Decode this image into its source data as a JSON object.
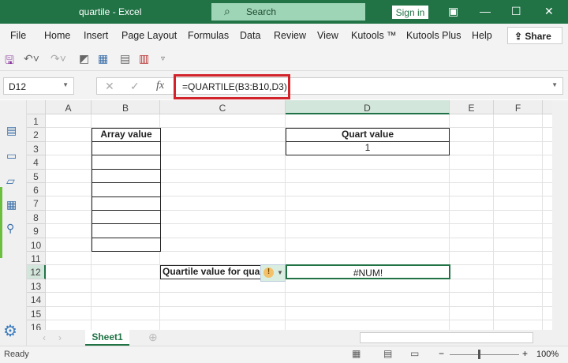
{
  "window": {
    "title": "quartile  -  Excel",
    "search": "Search",
    "sign_in": "Sign in"
  },
  "menu": {
    "items": [
      "File",
      "Home",
      "Insert",
      "Page Layout",
      "Formulas",
      "Data",
      "Review",
      "View",
      "Kutools ™",
      "Kutools Plus",
      "Help"
    ],
    "share": "Share"
  },
  "formula_bar": {
    "name_box": "D12",
    "formula": "=QUARTILE(B3:B10,D3)"
  },
  "columns": [
    "A",
    "B",
    "C",
    "D",
    "E",
    "F"
  ],
  "rows": [
    "1",
    "2",
    "3",
    "4",
    "5",
    "6",
    "7",
    "8",
    "9",
    "10",
    "11",
    "12",
    "13",
    "14",
    "15",
    "16"
  ],
  "cells": {
    "B2": "Array value",
    "D2": "Quart value",
    "D3": "1",
    "C12": "Quartile value for quart",
    "D12": "#NUM!"
  },
  "sheet_tabs": [
    "Sheet1"
  ],
  "status": {
    "ready": "Ready",
    "zoom": "100%"
  },
  "colors": {
    "title_bar": "#217346",
    "highlight": "#d2232a"
  }
}
